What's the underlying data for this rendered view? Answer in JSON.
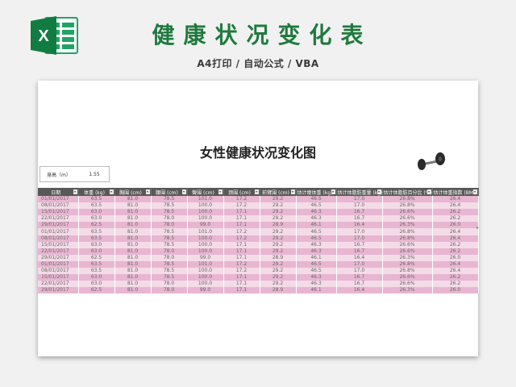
{
  "header": {
    "title": "健康状况变化表",
    "subtitle": "A4打印 / 自动公式 / VBA",
    "logo_letter": "X",
    "logo_icon": "excel-icon",
    "accent_color": "#1f7a3e"
  },
  "sheet": {
    "title": "女性健康状况变化图",
    "height_label": "身高（m）",
    "height_value": "1.55",
    "dumbbell_icon": "dumbbell-icon",
    "header_color": "#585858",
    "row_colors": [
      "#e8b6d1",
      "#f4dbe8"
    ],
    "columns": [
      "日期",
      "体重 (kg)",
      "胸围 (cm)",
      "腰围 (cm)",
      "臀围 (cm)",
      "颈围 (cm)",
      "前臂围 (cm)",
      "估计瘦体重 (kg)",
      "估计体脂肪重量 (kg)",
      "估计体脂肪百分比 (%)",
      "估计体重指数 (BMI)"
    ],
    "rows": [
      [
        "01/01/2017",
        "63.5",
        "81.0",
        "78.5",
        "101.0",
        "17.2",
        "29.2",
        "46.5",
        "17.0",
        "26.8%",
        "26.4"
      ],
      [
        "08/01/2017",
        "63.5",
        "81.0",
        "78.5",
        "100.0",
        "17.2",
        "29.2",
        "46.5",
        "17.0",
        "26.8%",
        "26.4"
      ],
      [
        "15/01/2017",
        "63.0",
        "81.0",
        "78.5",
        "100.0",
        "17.1",
        "29.2",
        "46.3",
        "16.7",
        "26.6%",
        "26.2"
      ],
      [
        "22/01/2017",
        "63.0",
        "81.0",
        "78.0",
        "100.0",
        "17.1",
        "29.2",
        "46.3",
        "16.7",
        "26.6%",
        "26.2"
      ],
      [
        "29/01/2017",
        "62.5",
        "81.0",
        "78.0",
        "99.0",
        "17.1",
        "28.9",
        "46.1",
        "16.4",
        "26.3%",
        "26.0"
      ],
      [
        "01/01/2017",
        "63.5",
        "81.0",
        "78.5",
        "101.0",
        "17.2",
        "29.2",
        "46.5",
        "17.0",
        "26.8%",
        "26.4"
      ],
      [
        "08/01/2017",
        "63.5",
        "81.0",
        "78.5",
        "100.0",
        "17.2",
        "29.2",
        "46.5",
        "17.0",
        "26.8%",
        "26.4"
      ],
      [
        "15/01/2017",
        "63.0",
        "81.0",
        "78.5",
        "100.0",
        "17.1",
        "29.2",
        "46.3",
        "16.7",
        "26.6%",
        "26.2"
      ],
      [
        "22/01/2017",
        "63.0",
        "81.0",
        "78.0",
        "100.0",
        "17.1",
        "29.2",
        "46.3",
        "16.7",
        "26.6%",
        "26.2"
      ],
      [
        "29/01/2017",
        "62.5",
        "81.0",
        "78.0",
        "99.0",
        "17.1",
        "28.9",
        "46.1",
        "16.4",
        "26.3%",
        "26.0"
      ],
      [
        "01/01/2017",
        "63.5",
        "81.0",
        "78.5",
        "101.0",
        "17.2",
        "29.2",
        "46.5",
        "17.0",
        "26.8%",
        "26.4"
      ],
      [
        "08/01/2017",
        "63.5",
        "81.0",
        "78.5",
        "100.0",
        "17.2",
        "29.2",
        "46.5",
        "17.0",
        "26.8%",
        "26.4"
      ],
      [
        "15/01/2017",
        "63.0",
        "81.0",
        "78.5",
        "100.0",
        "17.1",
        "29.2",
        "46.3",
        "16.7",
        "26.6%",
        "26.2"
      ],
      [
        "22/01/2017",
        "63.0",
        "81.0",
        "78.0",
        "100.0",
        "17.1",
        "29.2",
        "46.3",
        "16.7",
        "26.6%",
        "26.2"
      ],
      [
        "29/01/2017",
        "62.5",
        "81.0",
        "78.0",
        "99.0",
        "17.1",
        "28.9",
        "46.1",
        "16.4",
        "26.3%",
        "26.0"
      ]
    ]
  }
}
